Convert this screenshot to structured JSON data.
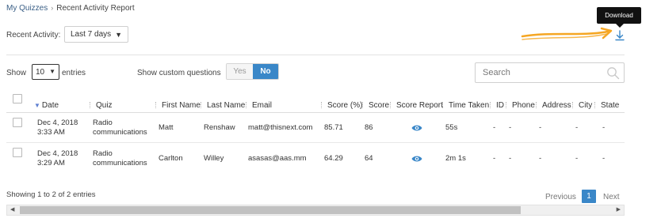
{
  "breadcrumb": {
    "root": "My Quizzes",
    "separator": "›",
    "current": "Recent Activity Report"
  },
  "filters": {
    "period_label": "Recent Activity:",
    "period_value": "Last 7 days"
  },
  "tooltip": {
    "text": "Download"
  },
  "download": {
    "icon": "download-icon",
    "arrow_color": "#f5a623"
  },
  "length": {
    "show_label": "Show",
    "value": "10",
    "entries_label": "entries"
  },
  "custom_questions": {
    "label": "Show custom questions",
    "yes": "Yes",
    "no": "No",
    "selected": "No"
  },
  "search": {
    "placeholder": "Search",
    "value": ""
  },
  "table": {
    "columns": [
      "Date",
      "Quiz",
      "First Name",
      "Last Name",
      "Email",
      "Score (%)",
      "Score",
      "Score Report",
      "Time Taken",
      "ID",
      "Phone",
      "Address",
      "City",
      "State"
    ],
    "rows": [
      {
        "date": "Dec 4, 2018",
        "time": "3:33 AM",
        "quiz_line1": "Radio",
        "quiz_line2": "communications",
        "first_name": "Matt",
        "last_name": "Renshaw",
        "email": "matt@thisnext.com",
        "score_pct": "85.71",
        "score": "86",
        "time_taken": "55s",
        "id": "-",
        "phone": "-",
        "address": "-",
        "city": "-",
        "state": "-"
      },
      {
        "date": "Dec 4, 2018",
        "time": "3:29 AM",
        "quiz_line1": "Radio",
        "quiz_line2": "communications",
        "first_name": "Carlton",
        "last_name": "Willey",
        "email": "asasas@aas.mm",
        "score_pct": "64.29",
        "score": "64",
        "time_taken": "2m 1s",
        "id": "-",
        "phone": "-",
        "address": "-",
        "city": "-",
        "state": "-"
      }
    ]
  },
  "footer": {
    "info": "Showing 1 to 2 of 2 entries",
    "previous": "Previous",
    "page": "1",
    "next": "Next"
  },
  "colors": {
    "accent": "#3a87c8",
    "link": "#3a5f86"
  }
}
